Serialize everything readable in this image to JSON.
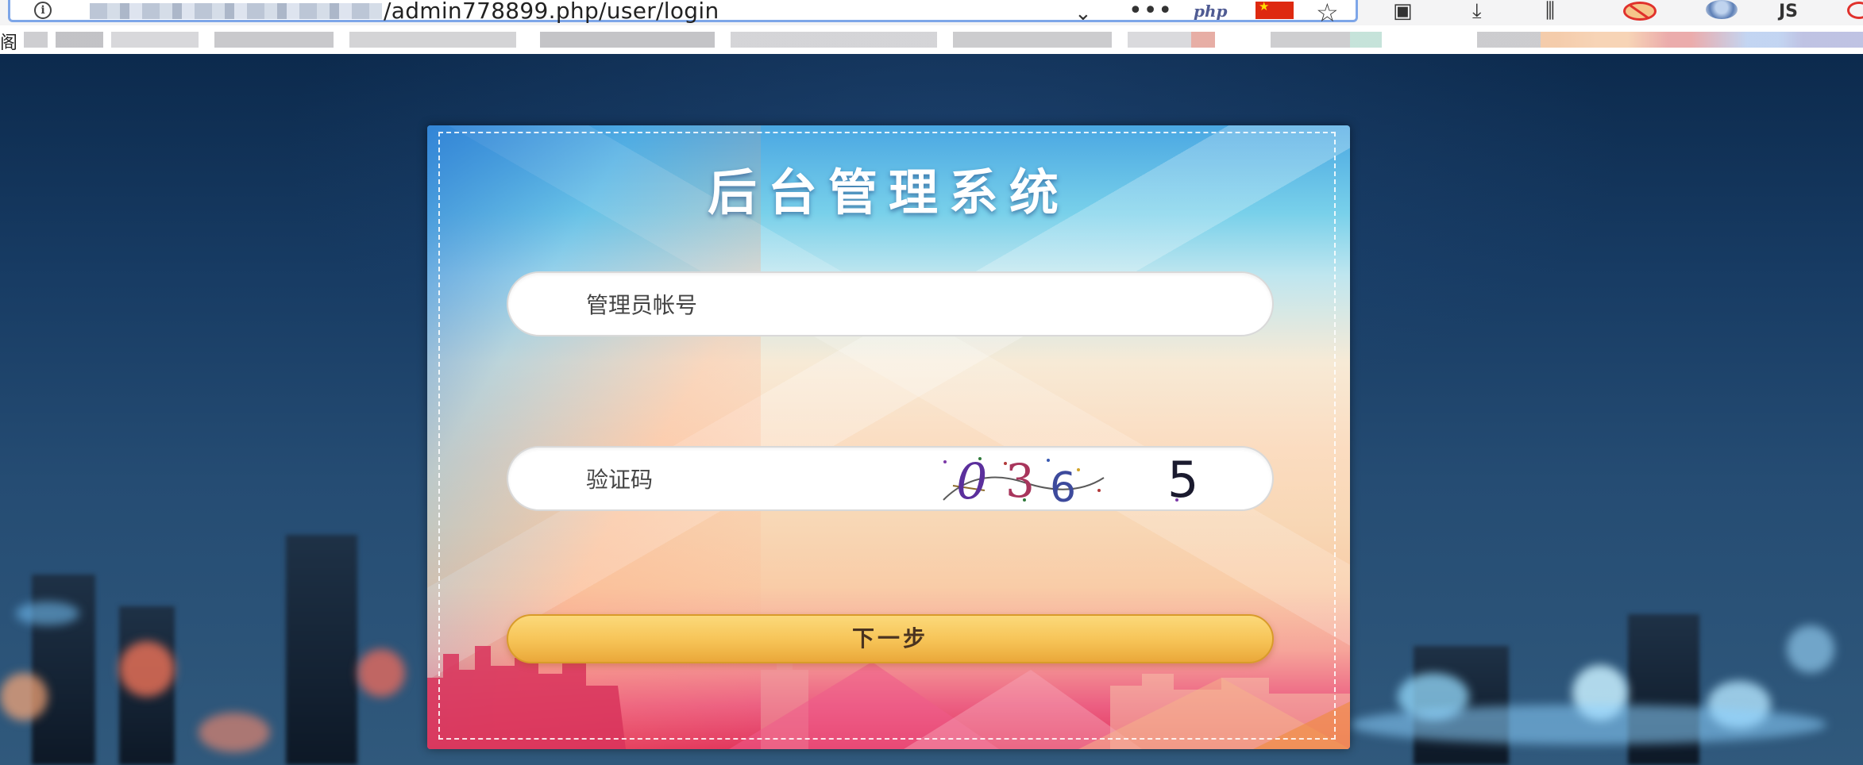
{
  "browser": {
    "url": "/admin778899.php/user/login",
    "php_badge": "php",
    "js_label": "JS",
    "bookmarks_first_char": "阁",
    "icons": [
      "info-icon",
      "chevron-down-icon",
      "more-dots-icon",
      "php-extension-icon",
      "china-flag-icon",
      "bookmark-star-icon",
      "reader-icon",
      "download-icon",
      "library-icon",
      "blocked-extension-icon",
      "extension-globe-icon",
      "js-toggle-icon"
    ]
  },
  "login": {
    "title": "后台管理系统",
    "account_placeholder": "管理员帐号",
    "captcha_placeholder": "验证码",
    "captcha_code": "0365",
    "next_button": "下一步"
  },
  "colors": {
    "panel_top": "#4aa7e2",
    "panel_bottom": "#e2355c",
    "button": "#f6c356",
    "background": "#173b63"
  }
}
